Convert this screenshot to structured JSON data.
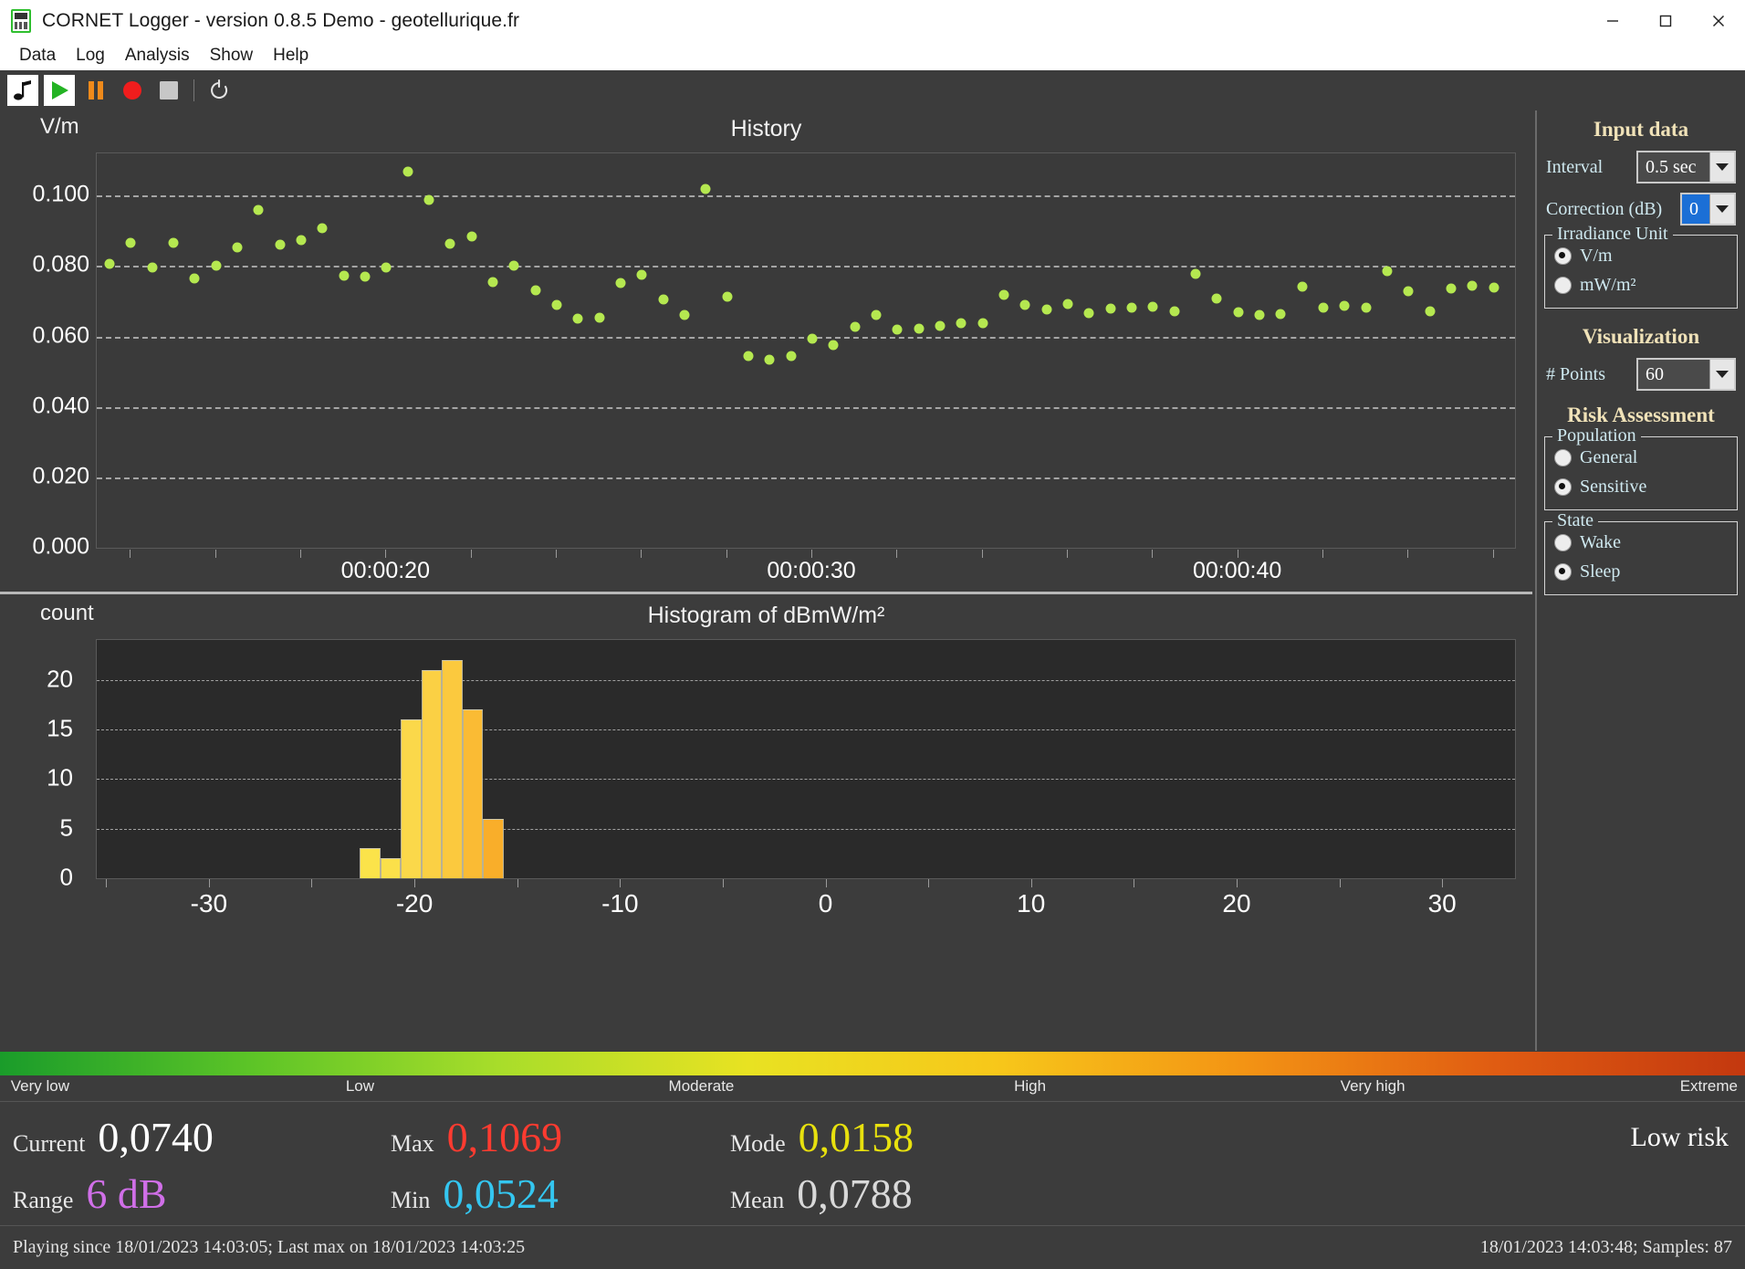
{
  "window": {
    "app_name": "CORNET Logger",
    "title": "CORNET Logger  - version 0.8.5 Demo - geotellurique.fr",
    "minimize_label": "─",
    "maximize_label": "□",
    "close_label": "✕"
  },
  "menubar": {
    "items": [
      {
        "label": "Data"
      },
      {
        "label": "Log"
      },
      {
        "label": "Analysis"
      },
      {
        "label": "Show"
      },
      {
        "label": "Help"
      }
    ]
  },
  "toolbar": {
    "buttons": [
      {
        "name": "sound-icon",
        "tip": "Sound"
      },
      {
        "name": "play-icon",
        "tip": "Play"
      },
      {
        "name": "pause-icon",
        "tip": "Pause"
      },
      {
        "name": "record-icon",
        "tip": "Record"
      },
      {
        "name": "stop-icon",
        "tip": "Stop"
      },
      {
        "name": "reset-icon",
        "tip": "Reset"
      }
    ]
  },
  "sidebar": {
    "input_data": {
      "heading": "Input data",
      "interval_label": "Interval",
      "interval_value": "0.5 sec",
      "correction_label": "Correction (dB)",
      "correction_value": "0",
      "irradiance_legend": "Irradiance Unit",
      "irradiance_options": [
        {
          "label": "V/m",
          "checked": true
        },
        {
          "label": "mW/m²",
          "checked": false
        }
      ]
    },
    "visualization": {
      "heading": "Visualization",
      "points_label": "# Points",
      "points_value": "60"
    },
    "risk_assessment": {
      "heading": "Risk Assessment",
      "population_legend": "Population",
      "population_options": [
        {
          "label": "General",
          "checked": false
        },
        {
          "label": "Sensitive",
          "checked": true
        }
      ],
      "state_legend": "State",
      "state_options": [
        {
          "label": "Wake",
          "checked": false
        },
        {
          "label": "Sleep",
          "checked": true
        }
      ]
    }
  },
  "scale": {
    "labels": [
      {
        "text": "Very low",
        "pos_pct": 0.3
      },
      {
        "text": "Low",
        "pos_pct": 19.5
      },
      {
        "text": "Moderate",
        "pos_pct": 38.0
      },
      {
        "text": "High",
        "pos_pct": 57.8
      },
      {
        "text": "Very high",
        "pos_pct": 76.5
      },
      {
        "text": "Extreme",
        "pos_pct": 99.7
      }
    ],
    "gradient_stops": [
      "#1a9c2a",
      "#5cc427",
      "#a8dd2a",
      "#e8e222",
      "#f7c71a",
      "#f39314",
      "#e05c12",
      "#c3380f"
    ]
  },
  "stats": {
    "items": [
      {
        "key": "Current",
        "value": "0,0740",
        "color": "#ffffff"
      },
      {
        "key": "Max",
        "value": "0,1069",
        "color": "#ff3b30"
      },
      {
        "key": "Mode",
        "value": "0,0158",
        "color": "#e8e10e"
      },
      {
        "key": "Range",
        "value": "6 dB",
        "color": "#d06fe8"
      },
      {
        "key": "Min",
        "value": "0,0524",
        "color": "#34c6f0"
      },
      {
        "key": "Mean",
        "value": "0,0788",
        "color": "#d9d9d9"
      }
    ],
    "risk_label": "Low risk"
  },
  "statusbar": {
    "left": "Playing since 18/01/2023 14:03:05; Last max on 18/01/2023 14:03:25",
    "right": "18/01/2023 14:03:48; Samples: 87"
  },
  "chart_data": [
    {
      "id": "history",
      "type": "scatter",
      "title": "History",
      "ylabel": "V/m",
      "xlabel": "",
      "grid": true,
      "point_color": "#b5e850",
      "ylim": [
        0.0,
        0.112
      ],
      "yticks": [
        0.0,
        0.02,
        0.04,
        0.06,
        0.08,
        0.1
      ],
      "ytick_labels": [
        "0.000",
        "0.020",
        "0.040",
        "0.060",
        "0.080",
        "0.100"
      ],
      "xlim": [
        13.2,
        46.5
      ],
      "xticks": [
        20,
        30,
        40
      ],
      "xtick_labels": [
        "00:00:20",
        "00:00:30",
        "00:00:40"
      ],
      "x": [
        13.5,
        14.0,
        14.5,
        15.0,
        15.5,
        16.0,
        16.5,
        17.0,
        17.5,
        18.0,
        18.5,
        19.0,
        19.5,
        20.0,
        20.5,
        21.0,
        21.5,
        22.0,
        22.5,
        23.0,
        23.5,
        24.0,
        24.5,
        25.0,
        25.5,
        26.0,
        26.5,
        27.0,
        27.5,
        28.0,
        28.5,
        29.0,
        29.5,
        30.0,
        30.5,
        31.0,
        31.5,
        32.0,
        32.5,
        33.0,
        33.5,
        34.0,
        34.5,
        35.0,
        35.5,
        36.0,
        36.5,
        37.0,
        37.5,
        38.0,
        38.5,
        39.0,
        39.5,
        40.0,
        40.5,
        41.0,
        41.5,
        42.0,
        42.5,
        43.0,
        43.5,
        44.0,
        44.5,
        45.0,
        45.5,
        46.0
      ],
      "y": [
        0.0806,
        0.0865,
        0.0795,
        0.0866,
        0.0766,
        0.08,
        0.0853,
        0.096,
        0.086,
        0.0873,
        0.0908,
        0.0772,
        0.0771,
        0.0797,
        0.1069,
        0.0989,
        0.0863,
        0.0884,
        0.0754,
        0.08,
        0.073,
        0.069,
        0.0651,
        0.0653,
        0.0751,
        0.0775,
        0.0705,
        0.0661,
        0.102,
        0.0713,
        0.0545,
        0.0535,
        0.0545,
        0.0595,
        0.0575,
        0.0628,
        0.066,
        0.0619,
        0.0623,
        0.063,
        0.0639,
        0.0638,
        0.0718,
        0.069,
        0.0676,
        0.0692,
        0.0666,
        0.0679,
        0.0681,
        0.0684,
        0.0672,
        0.0779,
        0.0709,
        0.0668,
        0.066,
        0.0663,
        0.0742,
        0.0683,
        0.0688,
        0.0681,
        0.0786,
        0.0728,
        0.0672,
        0.0737,
        0.0743,
        0.074
      ]
    },
    {
      "id": "histogram",
      "type": "bar",
      "title": "Histogram of dBmW/m²",
      "ylabel": "count",
      "xlabel": "",
      "grid": true,
      "ylim": [
        0,
        24
      ],
      "yticks": [
        0,
        5,
        10,
        15,
        20
      ],
      "ytick_labels": [
        "0",
        "5",
        "10",
        "15",
        "20"
      ],
      "xlim": [
        -35.5,
        33.5
      ],
      "xticks": [
        -30,
        -20,
        -10,
        0,
        10,
        20,
        30
      ],
      "xtick_labels": [
        "-30",
        "-20",
        "-10",
        "0",
        "10",
        "20",
        "30"
      ],
      "bin_centers": [
        -22.2,
        -21.2,
        -20.2,
        -19.2,
        -18.2,
        -17.2,
        -16.2
      ],
      "bin_width": 1.0,
      "values": [
        3,
        2,
        16,
        21,
        22,
        17,
        6
      ],
      "bar_colors": [
        "#fbe34a",
        "#fbe04a",
        "#fbd84a",
        "#fbd044",
        "#fbc93e",
        "#fabb34",
        "#f9ae2a"
      ]
    }
  ]
}
